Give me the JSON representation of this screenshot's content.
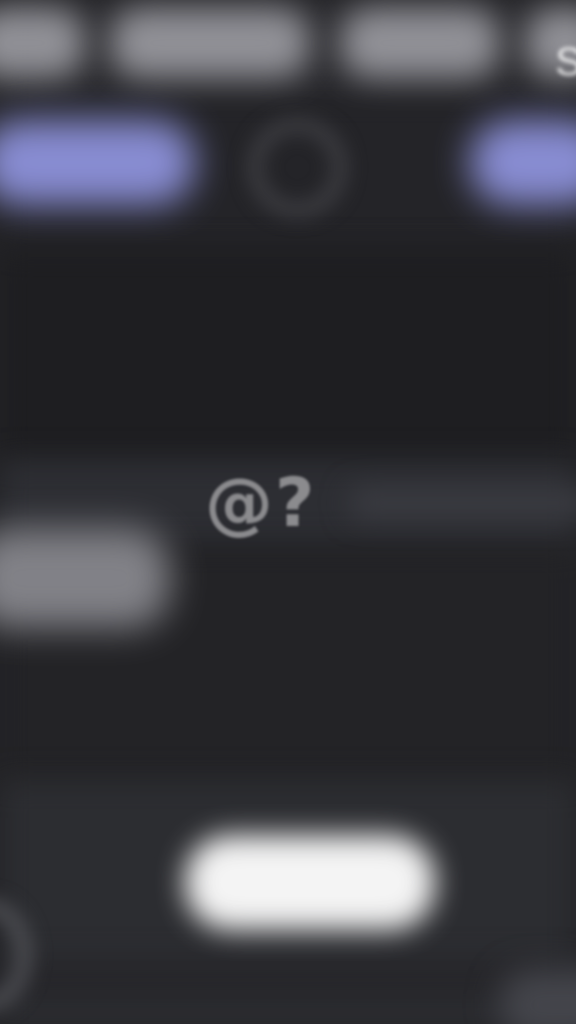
{
  "screen": {
    "background": "#232326",
    "edge_glyph": "S",
    "center_symbols": "@?",
    "colors": {
      "nav_accent": "#9a9ff0",
      "top_pills": "#9c9ca2",
      "bottom_button": "#f4f4f4",
      "symbol_text": "#8b8b8e"
    }
  },
  "icons": {
    "nav_center": "circle-icon",
    "bottom_left": "circle-icon"
  }
}
